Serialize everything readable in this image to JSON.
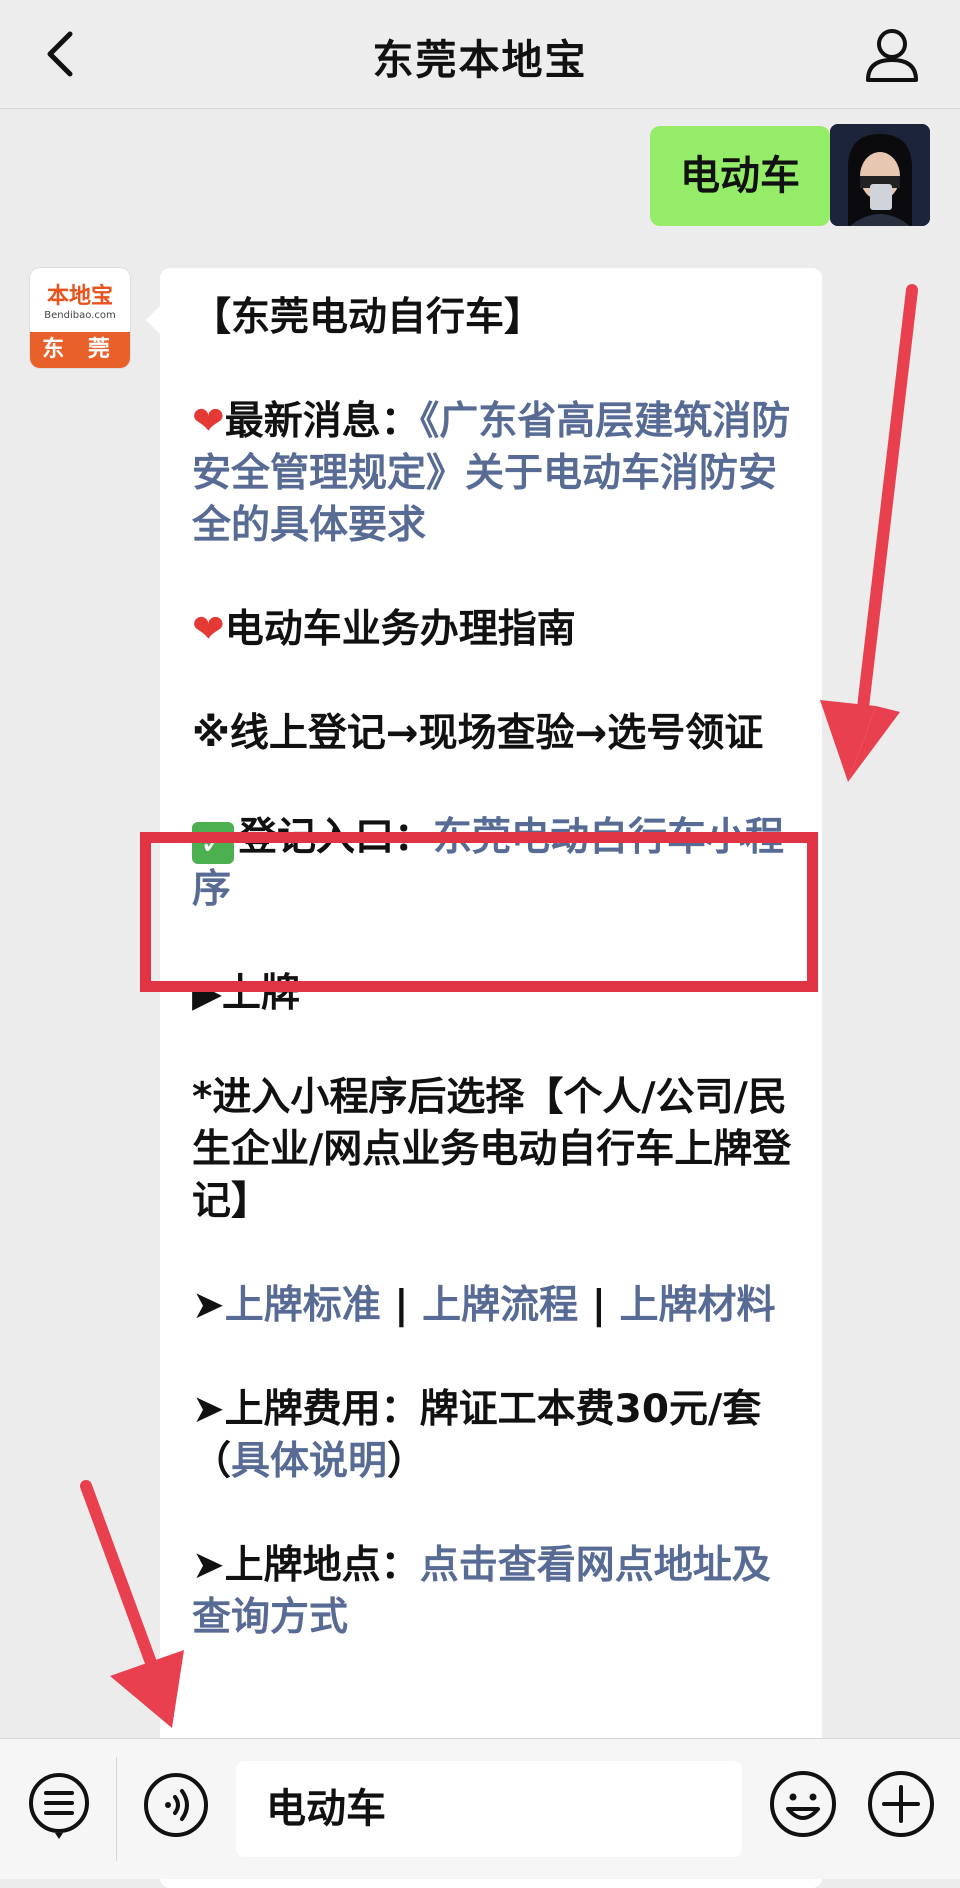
{
  "header": {
    "title": "东莞本地宝"
  },
  "user_message": {
    "text": "电动车"
  },
  "bot": {
    "avatar": {
      "logo_text": "本地宝",
      "logo_url_text": "Bendibao.com",
      "city_text": "东 莞"
    },
    "message": {
      "heading": "【东莞电动自行车】",
      "news_label": "最新消息：",
      "news_link": "《广东省高层建筑消防安全管理规定》关于电动车消防安全的具体要求",
      "guide_title": "电动车业务办理指南",
      "steps": "※线上登记→现场查验→选号领证",
      "entry_label": "登记入口：",
      "entry_link": "东莞电动自行车小程序",
      "plate_title": "▶上牌",
      "plate_note": "*进入小程序后选择【个人/公司/民生企业/网点业务电动自行车上牌登记】",
      "links_prefix": "➤",
      "link_standard": "上牌标准",
      "link_sep": " | ",
      "link_process": "上牌流程",
      "link_materials": "上牌材料",
      "fee_text": "➤上牌费用：牌证工本费30元/套（",
      "fee_link": "具体说明",
      "fee_close": "）",
      "location_label": "➤上牌地点：",
      "location_link": "点击查看网点地址及查询方式"
    }
  },
  "input": {
    "value": "电动车"
  },
  "icons": {
    "back": "chevron-left-icon",
    "profile": "person-icon",
    "menu": "menu-icon",
    "voice": "voice-icon",
    "emoji": "emoji-icon",
    "plus": "plus-icon"
  },
  "colors": {
    "link": "#576b95",
    "user_bubble": "#95ec69",
    "highlight": "#e03344",
    "arrow": "#e8404f"
  }
}
